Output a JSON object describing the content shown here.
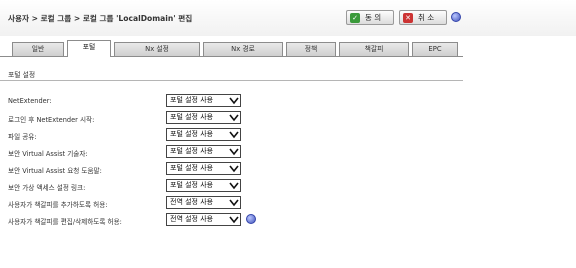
{
  "breadcrumb": "사용자 > 로컬 그룹 > 로컬 그룹 'LocalDomain' 편집",
  "buttons": {
    "ok": "동 의",
    "cancel": "취 소"
  },
  "tabs": [
    {
      "label": "일반",
      "active": false
    },
    {
      "label": "포털",
      "active": true
    },
    {
      "label": "Nx 설정",
      "active": false
    },
    {
      "label": "Nx 경로",
      "active": false
    },
    {
      "label": "정책",
      "active": false
    },
    {
      "label": "책갈피",
      "active": false
    },
    {
      "label": "EPC",
      "active": false
    }
  ],
  "section_title": "포털 설정",
  "settings": [
    {
      "label": "NetExtender:",
      "value": "포털 설정 사용"
    },
    {
      "label": "로그인 후 NetExtender 시작:",
      "value": "포털 설정 사용"
    },
    {
      "label": "파일 공유:",
      "value": "포털 설정 사용"
    },
    {
      "label": "보안 Virtual Assist 기술자:",
      "value": "포털 설정 사용"
    },
    {
      "label": "보안 Virtual Assist 요청 도움말:",
      "value": "포털 설정 사용"
    },
    {
      "label": "보안 가상 액세스 설정 링크:",
      "value": "포털 설정 사용"
    },
    {
      "label": "사용자가 책갈피를 추가하도록 허용:",
      "value": "전역 설정 사용"
    },
    {
      "label": "사용자가 책갈피를 편집/삭제하도록 허용:",
      "value": "전역 설정 사용"
    }
  ],
  "colors": {
    "ok_icon": "#3a9a3a",
    "cancel_icon": "#cc3333",
    "help_icon": "#4455bb"
  }
}
